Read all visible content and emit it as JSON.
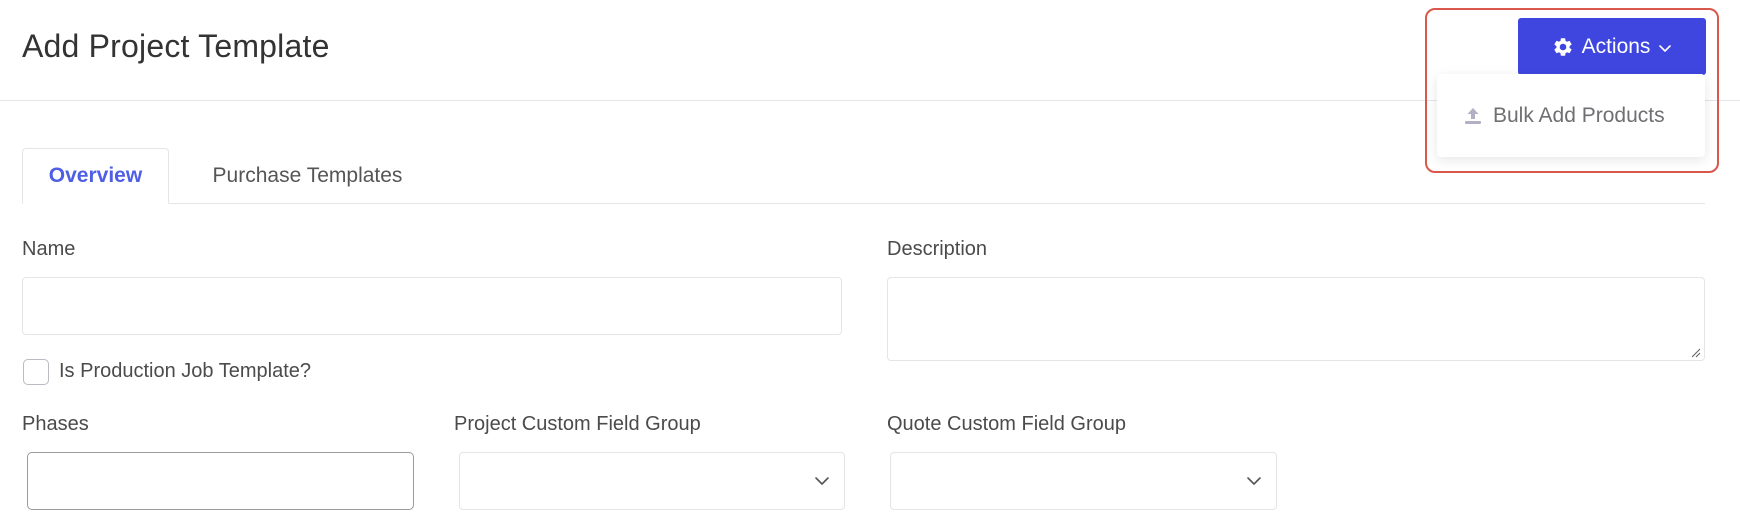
{
  "header": {
    "title": "Add Project Template",
    "actions_label": "Actions",
    "actions_icon": "gear-icon",
    "accent_color": "#3f46e0",
    "highlight_color": "#d9574b"
  },
  "actions_menu": {
    "items": [
      {
        "label": "Bulk Add Products",
        "icon": "upload-icon"
      }
    ]
  },
  "tabs": [
    {
      "label": "Overview",
      "active": true
    },
    {
      "label": "Purchase Templates",
      "active": false
    }
  ],
  "form": {
    "name": {
      "label": "Name",
      "value": ""
    },
    "description": {
      "label": "Description",
      "value": ""
    },
    "production_checkbox": {
      "label": "Is Production Job Template?",
      "checked": false
    },
    "phases": {
      "label": "Phases",
      "value": ""
    },
    "project_custom_field_group": {
      "label": "Project Custom Field Group",
      "selected": ""
    },
    "quote_custom_field_group": {
      "label": "Quote Custom Field Group",
      "selected": ""
    }
  }
}
